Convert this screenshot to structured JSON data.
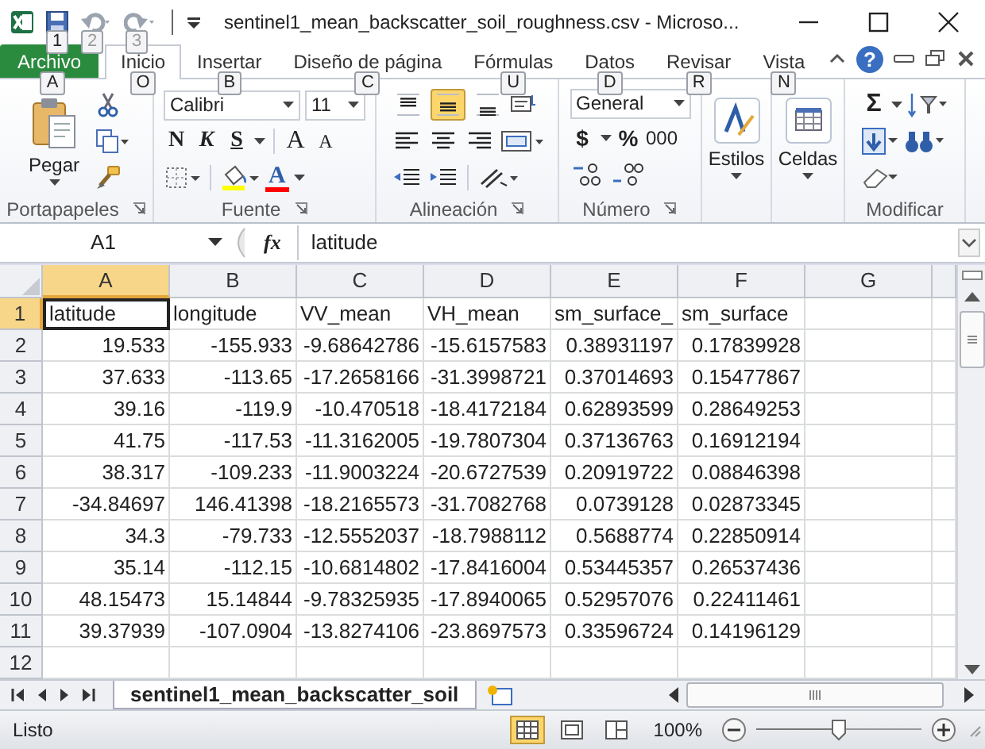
{
  "title_bar": {
    "title": "sentinel1_mean_backscatter_soil_roughness.csv  -  Microso...",
    "keytips": [
      "1",
      "2",
      "3"
    ]
  },
  "ribbon_tabs": [
    {
      "label": "Archivo",
      "kind": "file",
      "selected": false,
      "keytip": "A"
    },
    {
      "label": "Inicio",
      "kind": "tab",
      "selected": true,
      "keytip": "O"
    },
    {
      "label": "Insertar",
      "kind": "tab",
      "selected": false,
      "keytip": "B"
    },
    {
      "label": "Diseño de página",
      "kind": "tab",
      "selected": false,
      "keytip": "C"
    },
    {
      "label": "Fórmulas",
      "kind": "tab",
      "selected": false,
      "keytip": "U"
    },
    {
      "label": "Datos",
      "kind": "tab",
      "selected": false,
      "keytip": "D"
    },
    {
      "label": "Revisar",
      "kind": "tab",
      "selected": false,
      "keytip": "R"
    },
    {
      "label": "Vista",
      "kind": "tab",
      "selected": false,
      "keytip": "N"
    }
  ],
  "help": "?",
  "ribbon_groups": [
    {
      "kind": "clipboard",
      "label": "Portapapeles",
      "paste": "Pegar"
    },
    {
      "kind": "font",
      "label": "Fuente",
      "font_name": "Calibri",
      "font_size": "11",
      "bold": "N",
      "italic": "K",
      "underline": "S",
      "grow": "A",
      "shrink": "A",
      "font_color": "A"
    },
    {
      "kind": "alignment",
      "label": "Alineación",
      "vertical_align": [
        {
          "selected": false
        },
        {
          "selected": true
        },
        {
          "selected": false
        }
      ]
    },
    {
      "kind": "number",
      "label": "Número",
      "format": "General",
      "currency": "$",
      "percent": "%",
      "thousands": "000"
    },
    {
      "kind": "styles",
      "label": "Estilos"
    },
    {
      "kind": "cells",
      "label": "Celdas"
    },
    {
      "kind": "editing",
      "label": "Modificar",
      "sum": "Σ"
    }
  ],
  "formula_bar": {
    "name_box": "A1",
    "fx": "fx",
    "formula": "latitude"
  },
  "sheet": {
    "columns": [
      {
        "label": "A",
        "selected": true
      },
      {
        "label": "B",
        "selected": false
      },
      {
        "label": "C",
        "selected": false
      },
      {
        "label": "D",
        "selected": false
      },
      {
        "label": "E",
        "selected": false
      },
      {
        "label": "F",
        "selected": false
      },
      {
        "label": "G",
        "selected": false
      }
    ],
    "rows": [
      {
        "number": "1",
        "kind": "text",
        "selected": true,
        "cells": [
          "latitude",
          "longitude",
          "VV_mean",
          "VH_mean",
          "sm_surface_",
          "sm_surface"
        ]
      },
      {
        "number": "2",
        "kind": "number",
        "selected": false,
        "cells": [
          "19.533",
          "-155.933",
          "-9.68642786",
          "-15.6157583",
          "0.38931197",
          "0.17839928"
        ]
      },
      {
        "number": "3",
        "kind": "number",
        "selected": false,
        "cells": [
          "37.633",
          "-113.65",
          "-17.2658166",
          "-31.3998721",
          "0.37014693",
          "0.15477867"
        ]
      },
      {
        "number": "4",
        "kind": "number",
        "selected": false,
        "cells": [
          "39.16",
          "-119.9",
          "-10.470518",
          "-18.4172184",
          "0.62893599",
          "0.28649253"
        ]
      },
      {
        "number": "5",
        "kind": "number",
        "selected": false,
        "cells": [
          "41.75",
          "-117.53",
          "-11.3162005",
          "-19.7807304",
          "0.37136763",
          "0.16912194"
        ]
      },
      {
        "number": "6",
        "kind": "number",
        "selected": false,
        "cells": [
          "38.317",
          "-109.233",
          "-11.9003224",
          "-20.6727539",
          "0.20919722",
          "0.08846398"
        ]
      },
      {
        "number": "7",
        "kind": "number",
        "selected": false,
        "cells": [
          "-34.84697",
          "146.41398",
          "-18.2165573",
          "-31.7082768",
          "0.0739128",
          "0.02873345"
        ]
      },
      {
        "number": "8",
        "kind": "number",
        "selected": false,
        "cells": [
          "34.3",
          "-79.733",
          "-12.5552037",
          "-18.7988112",
          "0.5688774",
          "0.22850914"
        ]
      },
      {
        "number": "9",
        "kind": "number",
        "selected": false,
        "cells": [
          "35.14",
          "-112.15",
          "-10.6814802",
          "-17.8416004",
          "0.53445357",
          "0.26537436"
        ]
      },
      {
        "number": "10",
        "kind": "number",
        "selected": false,
        "cells": [
          "48.15473",
          "15.14844",
          "-9.78325935",
          "-17.8940065",
          "0.52957076",
          "0.22411461"
        ]
      },
      {
        "number": "11",
        "kind": "number",
        "selected": false,
        "cells": [
          "39.37939",
          "-107.0904",
          "-13.8274106",
          "-23.8697573",
          "0.33596724",
          "0.14196129"
        ]
      },
      {
        "number": "12",
        "kind": "empty",
        "selected": false
      }
    ]
  },
  "sheet_tabs": [
    {
      "label": "sentinel1_mean_backscatter_soil",
      "selected": true
    }
  ],
  "status_bar": {
    "status": "Listo",
    "views": [
      {
        "selected": true
      },
      {
        "selected": false
      },
      {
        "selected": false
      }
    ],
    "zoom": "100%",
    "zoom_slider": {
      "level": 0.5
    }
  }
}
